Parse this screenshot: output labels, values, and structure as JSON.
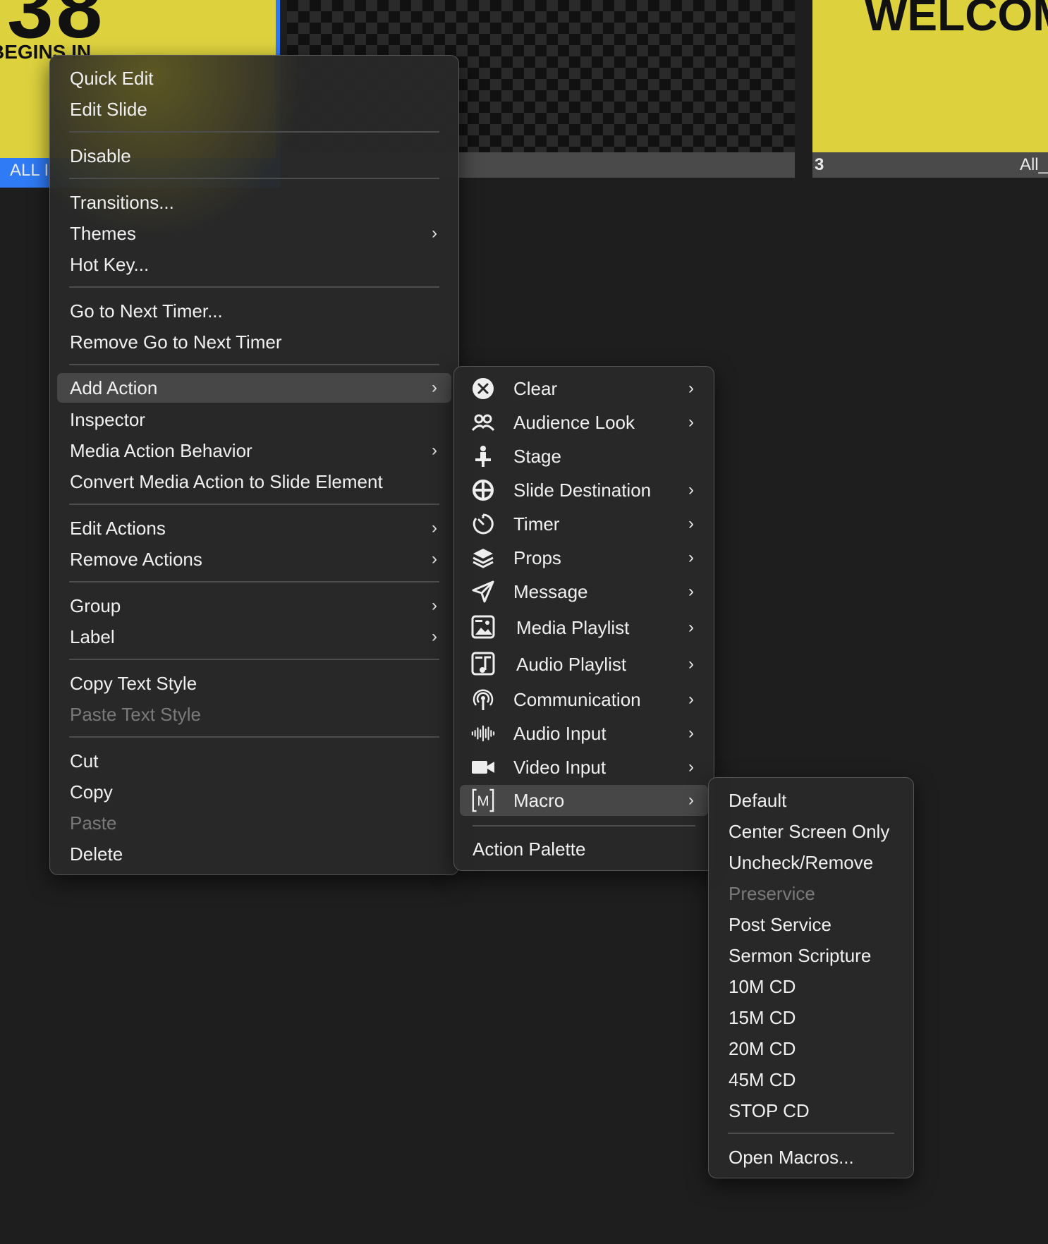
{
  "slides": [
    {
      "big_text": "38",
      "caption": "BEGINS IN",
      "label": "ALL I",
      "selected": true
    },
    {
      "big_text": "",
      "caption": "",
      "label": "",
      "selected": false
    },
    {
      "big_text": "WELCOM",
      "caption": "",
      "number": "3",
      "label": "All_",
      "selected": false
    }
  ],
  "context_menu": {
    "items": [
      {
        "label": "Quick Edit"
      },
      {
        "label": "Edit Slide"
      },
      {
        "label": "Disable"
      },
      {
        "label": "Transitions..."
      },
      {
        "label": "Themes",
        "submenu": true
      },
      {
        "label": "Hot Key..."
      },
      {
        "label": "Go to Next Timer..."
      },
      {
        "label": "Remove Go to Next Timer"
      },
      {
        "label": "Add Action",
        "submenu": true,
        "highlighted": true
      },
      {
        "label": "Inspector"
      },
      {
        "label": "Media Action Behavior",
        "submenu": true
      },
      {
        "label": "Convert Media Action to Slide Element"
      },
      {
        "label": "Edit Actions",
        "submenu": true
      },
      {
        "label": "Remove Actions",
        "submenu": true
      },
      {
        "label": "Group",
        "submenu": true
      },
      {
        "label": "Label",
        "submenu": true
      },
      {
        "label": "Copy Text Style"
      },
      {
        "label": "Paste Text Style",
        "disabled": true
      },
      {
        "label": "Cut"
      },
      {
        "label": "Copy"
      },
      {
        "label": "Paste",
        "disabled": true
      },
      {
        "label": "Delete"
      }
    ]
  },
  "add_action_menu": {
    "items": [
      {
        "label": "Clear",
        "icon": "clear-icon"
      },
      {
        "label": "Audience Look",
        "icon": "audience-look-icon"
      },
      {
        "label": "Stage",
        "icon": "stage-icon"
      },
      {
        "label": "Slide Destination",
        "icon": "slide-destination-icon"
      },
      {
        "label": "Timer",
        "icon": "timer-icon"
      },
      {
        "label": "Props",
        "icon": "props-icon"
      },
      {
        "label": "Message",
        "icon": "message-icon"
      },
      {
        "label": "Media Playlist",
        "icon": "media-playlist-icon"
      },
      {
        "label": "Audio Playlist",
        "icon": "audio-playlist-icon"
      },
      {
        "label": "Communication",
        "icon": "communication-icon"
      },
      {
        "label": "Audio Input",
        "icon": "audio-input-icon"
      },
      {
        "label": "Video Input",
        "icon": "video-input-icon"
      },
      {
        "label": "Macro",
        "icon": "macro-icon",
        "highlighted": true
      },
      {
        "label": "Action Palette"
      }
    ]
  },
  "macro_menu": {
    "items": [
      {
        "label": "Default"
      },
      {
        "label": "Center Screen Only"
      },
      {
        "label": "Uncheck/Remove"
      },
      {
        "label": "Preservice",
        "disabled": true
      },
      {
        "label": "Post Service"
      },
      {
        "label": "Sermon Scripture"
      },
      {
        "label": "10M CD"
      },
      {
        "label": "15M CD"
      },
      {
        "label": "20M CD"
      },
      {
        "label": "45M CD"
      },
      {
        "label": "STOP CD"
      },
      {
        "label": "Open Macros..."
      }
    ]
  },
  "colors": {
    "background": "#1e1e1e",
    "menu_bg": "#282828",
    "highlight": "#474747",
    "slide_yellow": "#ddd23e",
    "selection_blue": "#2f7bf5"
  }
}
